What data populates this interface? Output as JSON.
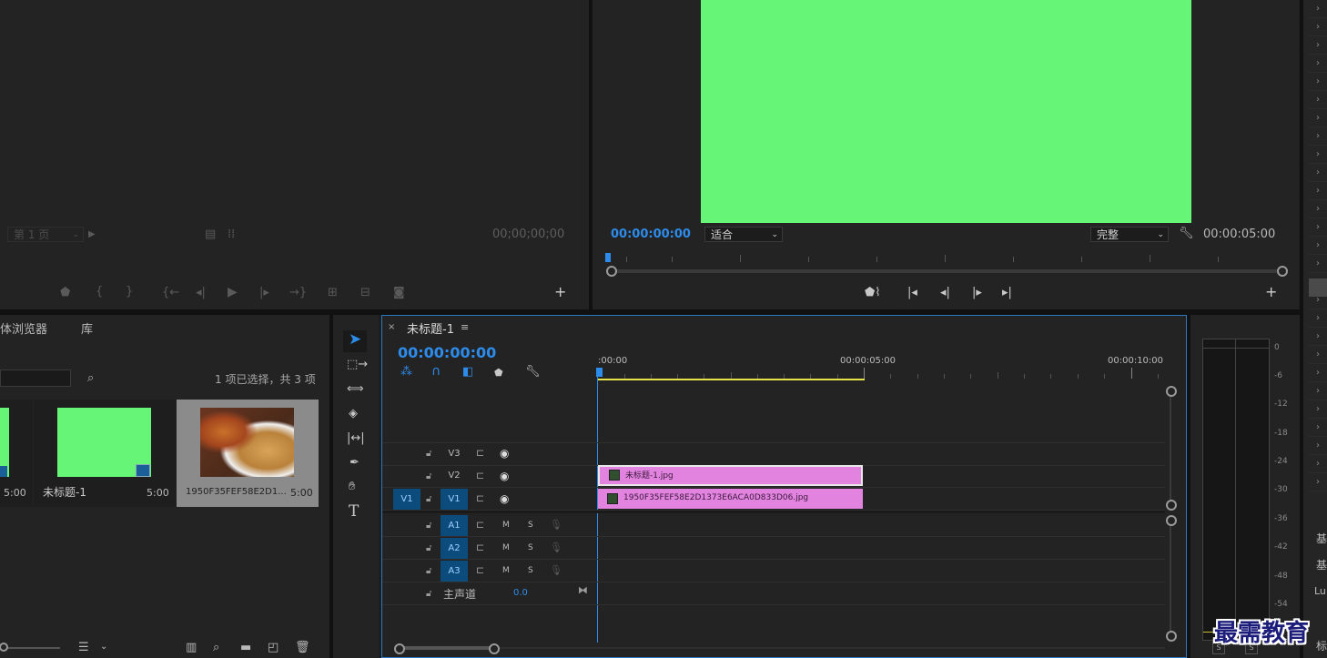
{
  "source_monitor": {
    "page_select": "第 1 页",
    "timecode": "00;00;00;00"
  },
  "program_monitor": {
    "timecode_left": "00:00:00:00",
    "fit_select": "适合",
    "quality_select": "完整",
    "timecode_right": "00:00:05:00",
    "frame_color": "#67f577"
  },
  "project_panel": {
    "tabs": [
      "体浏览器",
      "库"
    ],
    "selection_status": "1 项已选择，共 3 项",
    "items": [
      {
        "name": "",
        "duration": "5:00",
        "thumb_color": "#67f577"
      },
      {
        "name": "未标题-1",
        "duration": "5:00",
        "thumb_color": "#67f577"
      },
      {
        "name": "1950F35FEF58E2D1...",
        "duration": "5:00",
        "thumb_color": "food-photo"
      }
    ]
  },
  "timeline": {
    "tab_title": "未标题-1",
    "timecode": "00:00:00:00",
    "ruler_labels": [
      ":00:00",
      "00:00:05:00",
      "00:00:10:00"
    ],
    "video_tracks": [
      {
        "name": "V3",
        "source": ""
      },
      {
        "name": "V2",
        "source": ""
      },
      {
        "name": "V1",
        "source": "V1"
      }
    ],
    "audio_tracks": [
      {
        "name": "A1",
        "m": "M",
        "s": "S"
      },
      {
        "name": "A2",
        "m": "M",
        "s": "S"
      },
      {
        "name": "A3",
        "m": "M",
        "s": "S"
      }
    ],
    "master": {
      "label": "主声道",
      "value": "0.0"
    },
    "clips": [
      {
        "track": "V2",
        "label": "未标题-1.jpg"
      },
      {
        "track": "V1",
        "label": "1950F35FEF58E2D1373E6ACA0D833D06.jpg"
      }
    ],
    "clip_color": "#e283df"
  },
  "audio_meter": {
    "scale": [
      "0",
      "-6",
      "-12",
      "-18",
      "-24",
      "-30",
      "-36",
      "-42",
      "-48",
      "-54"
    ],
    "solo_labels": [
      "S",
      "S"
    ]
  },
  "right_panel": {
    "items": [
      "基",
      "基",
      "Lu",
      "标"
    ]
  },
  "watermark": "最需教育"
}
